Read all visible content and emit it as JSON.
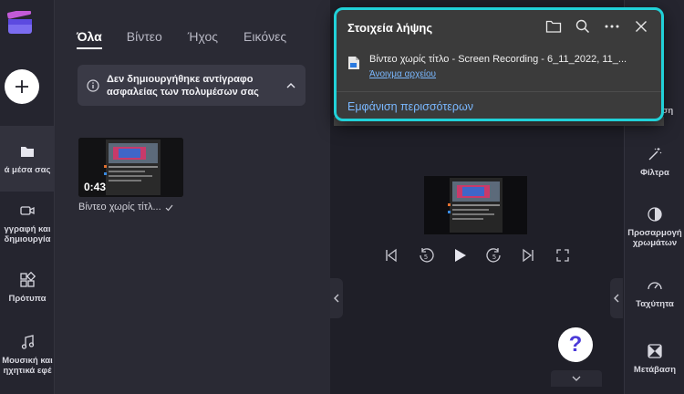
{
  "rail": {
    "items": [
      {
        "label": "Τα μέσα σας",
        "display": "ά μέσα σας"
      },
      {
        "label": "Εγγραφή και δημιουργία",
        "line1": "γγραφή και",
        "line2": "δημιουργία"
      },
      {
        "label": "Πρότυπα",
        "display": "Πρότυπα"
      },
      {
        "label": "Μουσική και ηχητικά εφέ",
        "line1": "Μουσική και",
        "line2": "ηχητικά εφέ"
      }
    ]
  },
  "media": {
    "tabs": [
      "Όλα",
      "Βίντεο",
      "Ήχος",
      "Εικόνες"
    ],
    "backup_notice": "Δεν δημιουργήθηκε αντίγραφο ασφαλείας των πολυμέσων σας",
    "item": {
      "title": "Βίντεο χωρίς τίτλ...",
      "duration": "0:43"
    }
  },
  "right_panel": {
    "items": [
      "Φίλτρα",
      "Προσαρμογή χρωμάτων",
      "Ταχύτητα",
      "Μετάβαση"
    ],
    "item2_line1": "Προσαρμογή",
    "item2_line2": "χρωμάτων",
    "partial_label": "άση"
  },
  "downloads": {
    "title": "Στοιχεία λήψης",
    "file_name": "Βίντεο χωρίς τίτλο - Screen Recording - 6_11_2022, 11_...",
    "open_file": "Άνοιγμα αρχείου",
    "show_more": "Εμφάνιση περισσότερων"
  },
  "help": {
    "label": "?"
  },
  "colors": {
    "accent": "#21d1d8",
    "link": "#7ab8ff",
    "help_icon": "#4b3ad8"
  }
}
